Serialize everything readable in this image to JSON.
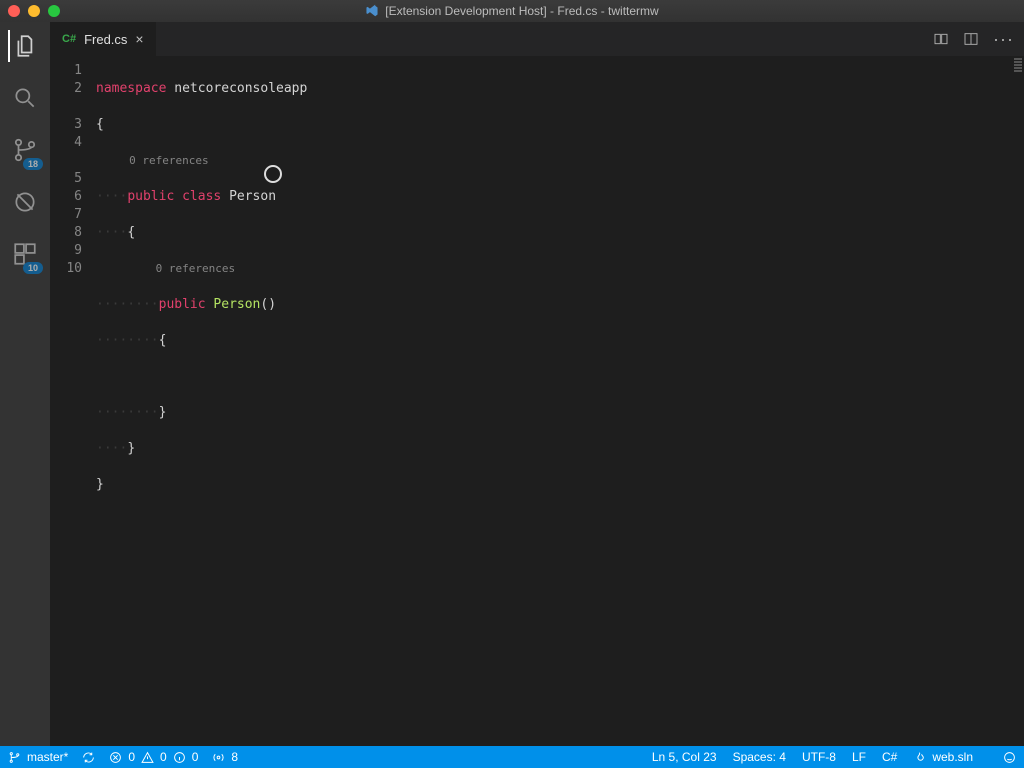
{
  "title": "[Extension Development Host] - Fred.cs - twittermw",
  "tab": {
    "lang": "C#",
    "filename": "Fred.cs"
  },
  "activity_badges": {
    "scm": "18",
    "extensions": "10"
  },
  "codelens": {
    "class": "0 references",
    "ctor": "0 references"
  },
  "line_numbers": [
    "1",
    "2",
    "3",
    "4",
    "5",
    "6",
    "7",
    "8",
    "9",
    "10"
  ],
  "code": {
    "ns": "namespace",
    "ns_name": "netcoreconsoleapp",
    "obrace": "{",
    "cbrace": "}",
    "public": "public",
    "class": "class",
    "class_name": "Person",
    "ctor_name": "Person",
    "parens": "()",
    "ws4": "····",
    "ws8": "········"
  },
  "statusbar": {
    "branch": "master*",
    "errors": "0",
    "warnings": "0",
    "info": "0",
    "messages": "8",
    "ln_col": "Ln 5, Col 23",
    "spaces": "Spaces: 4",
    "encoding": "UTF-8",
    "eol": "LF",
    "lang": "C#",
    "sln": "web.sln"
  }
}
